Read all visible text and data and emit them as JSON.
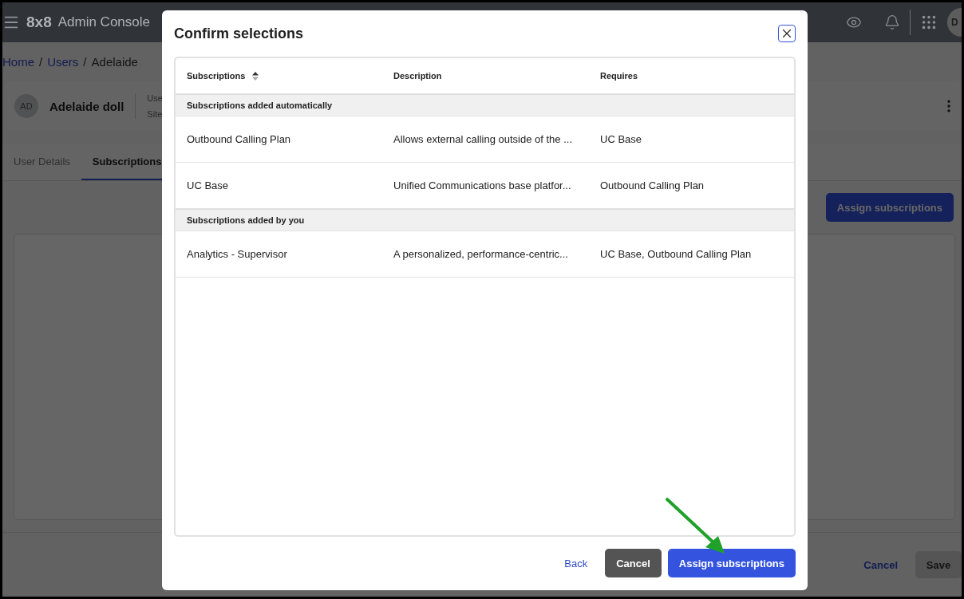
{
  "app": {
    "logo": "8x8",
    "title": "Admin Console",
    "avatar": "D"
  },
  "breadcrumb": {
    "separator": "/",
    "items": [
      {
        "label": "Home",
        "link": true
      },
      {
        "label": "Users",
        "link": true
      },
      {
        "label": "Adelaide",
        "link": false
      }
    ]
  },
  "user": {
    "initials": "AD",
    "name": "Adelaide doll",
    "fields": [
      "Use",
      "Site"
    ]
  },
  "tabs": [
    {
      "label": "User Details",
      "selected": false
    },
    {
      "label": "Subscriptions",
      "selected": true
    }
  ],
  "assign_button": "Assign subscriptions",
  "footer": {
    "cancel": "Cancel",
    "save": {
      "label": "Save",
      "disabled": true
    }
  },
  "dialog": {
    "title": "Confirm selections",
    "columns": [
      {
        "label": "Subscriptions"
      },
      {
        "label": "Description"
      },
      {
        "label": "Requires"
      }
    ],
    "groups": [
      {
        "label": "Subscriptions added automatically",
        "rows": [
          [
            "Outbound Calling Plan",
            "Allows external calling outside of the ...",
            "UC Base"
          ],
          [
            "UC Base",
            "Unified Communications base platfor...",
            "Outbound Calling Plan"
          ]
        ]
      },
      {
        "label": "Subscriptions added by you",
        "rows": [
          [
            "Analytics - Supervisor",
            "A personalized, performance-centric...",
            "UC Base, Outbound Calling Plan"
          ]
        ]
      }
    ],
    "buttons": [
      {
        "label": "Back",
        "kind": "link"
      },
      {
        "label": "Cancel",
        "kind": "secondary"
      },
      {
        "label": "Assign subscriptions",
        "kind": "primary"
      }
    ]
  }
}
